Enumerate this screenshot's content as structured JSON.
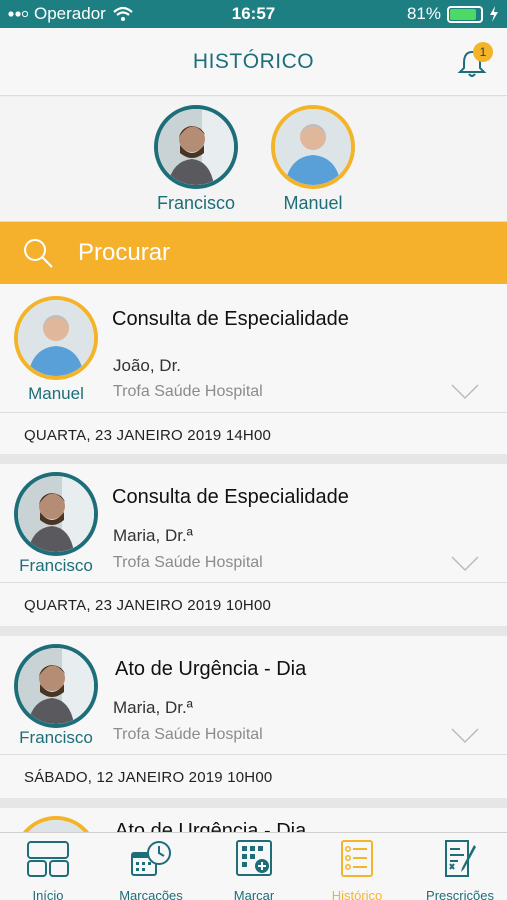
{
  "status_bar": {
    "carrier": "Operador",
    "time": "16:57",
    "battery": "81%"
  },
  "header": {
    "title": "HISTÓRICO",
    "notification_count": "1"
  },
  "profiles": [
    {
      "name": "Francisco",
      "border": "#1e6e79"
    },
    {
      "name": "Manuel",
      "border": "#f4b42a"
    }
  ],
  "search": {
    "placeholder": "Procurar"
  },
  "records": [
    {
      "person": "Manuel",
      "title": "Consulta de Especialidade",
      "doctor": "João, Dr.",
      "place": "Trofa Saúde Hospital",
      "date": "QUARTA, 23 JANEIRO 2019  14H00"
    },
    {
      "person": "Francisco",
      "title": "Consulta de Especialidade",
      "doctor": "Maria, Dr.ª",
      "place": "Trofa Saúde Hospital",
      "date": "QUARTA, 23 JANEIRO 2019  10H00"
    },
    {
      "person": "Francisco",
      "title": "Ato de Urgência - Dia",
      "doctor": "Maria, Dr.ª",
      "place": "Trofa Saúde Hospital",
      "date": "SÁBADO, 12 JANEIRO 2019  10H00"
    },
    {
      "person": "Manuel",
      "title": "Ato de Urgência - Dia"
    }
  ],
  "tabs": [
    {
      "label": "Início",
      "icon": "home-grid-icon"
    },
    {
      "label": "Marcações",
      "icon": "calendar-clock-icon"
    },
    {
      "label": "Marcar",
      "icon": "add-appointment-icon"
    },
    {
      "label": "Histórico",
      "icon": "history-list-icon",
      "active": true
    },
    {
      "label": "Prescrições",
      "icon": "prescription-icon"
    }
  ],
  "colors": {
    "primary": "#1e6e79",
    "accent": "#f4b42a",
    "status_bar": "#1e7f83"
  }
}
